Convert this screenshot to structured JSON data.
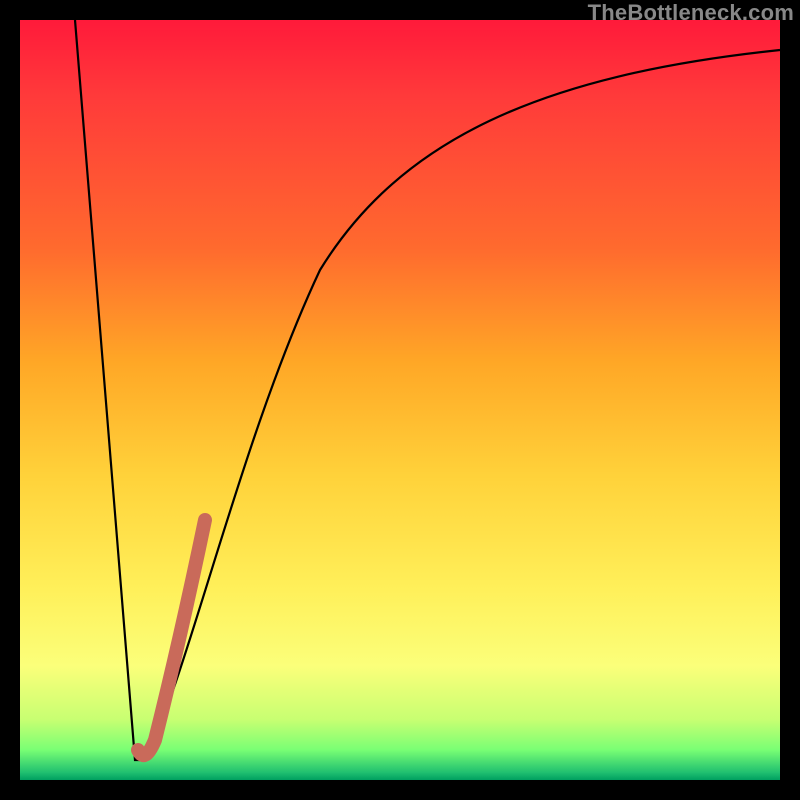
{
  "watermark": "TheBottleneck.com",
  "colors": {
    "background": "#000000",
    "curve_black": "#000000",
    "highlight_stroke": "#c96a5a"
  },
  "chart_data": {
    "type": "line",
    "title": "",
    "xlabel": "",
    "ylabel": "",
    "xlim": [
      0,
      100
    ],
    "ylim": [
      0,
      100
    ],
    "series": [
      {
        "name": "bottleneck-curve",
        "x": [
          0,
          5,
          10,
          12,
          14,
          15,
          16,
          18,
          20,
          24,
          28,
          32,
          36,
          40,
          45,
          50,
          55,
          60,
          65,
          70,
          75,
          80,
          85,
          90,
          95,
          100
        ],
        "values": [
          100,
          67,
          33,
          20,
          7,
          0,
          6,
          20,
          32,
          50,
          62,
          70,
          76,
          80,
          84,
          87,
          89,
          90.5,
          92,
          93,
          93.8,
          94.4,
          94.9,
          95.3,
          95.6,
          95.8
        ]
      },
      {
        "name": "highlight-segment",
        "x": [
          14,
          15,
          16,
          18,
          20,
          22
        ],
        "values": [
          5,
          1,
          5,
          15,
          28,
          38
        ]
      }
    ],
    "annotations": []
  }
}
